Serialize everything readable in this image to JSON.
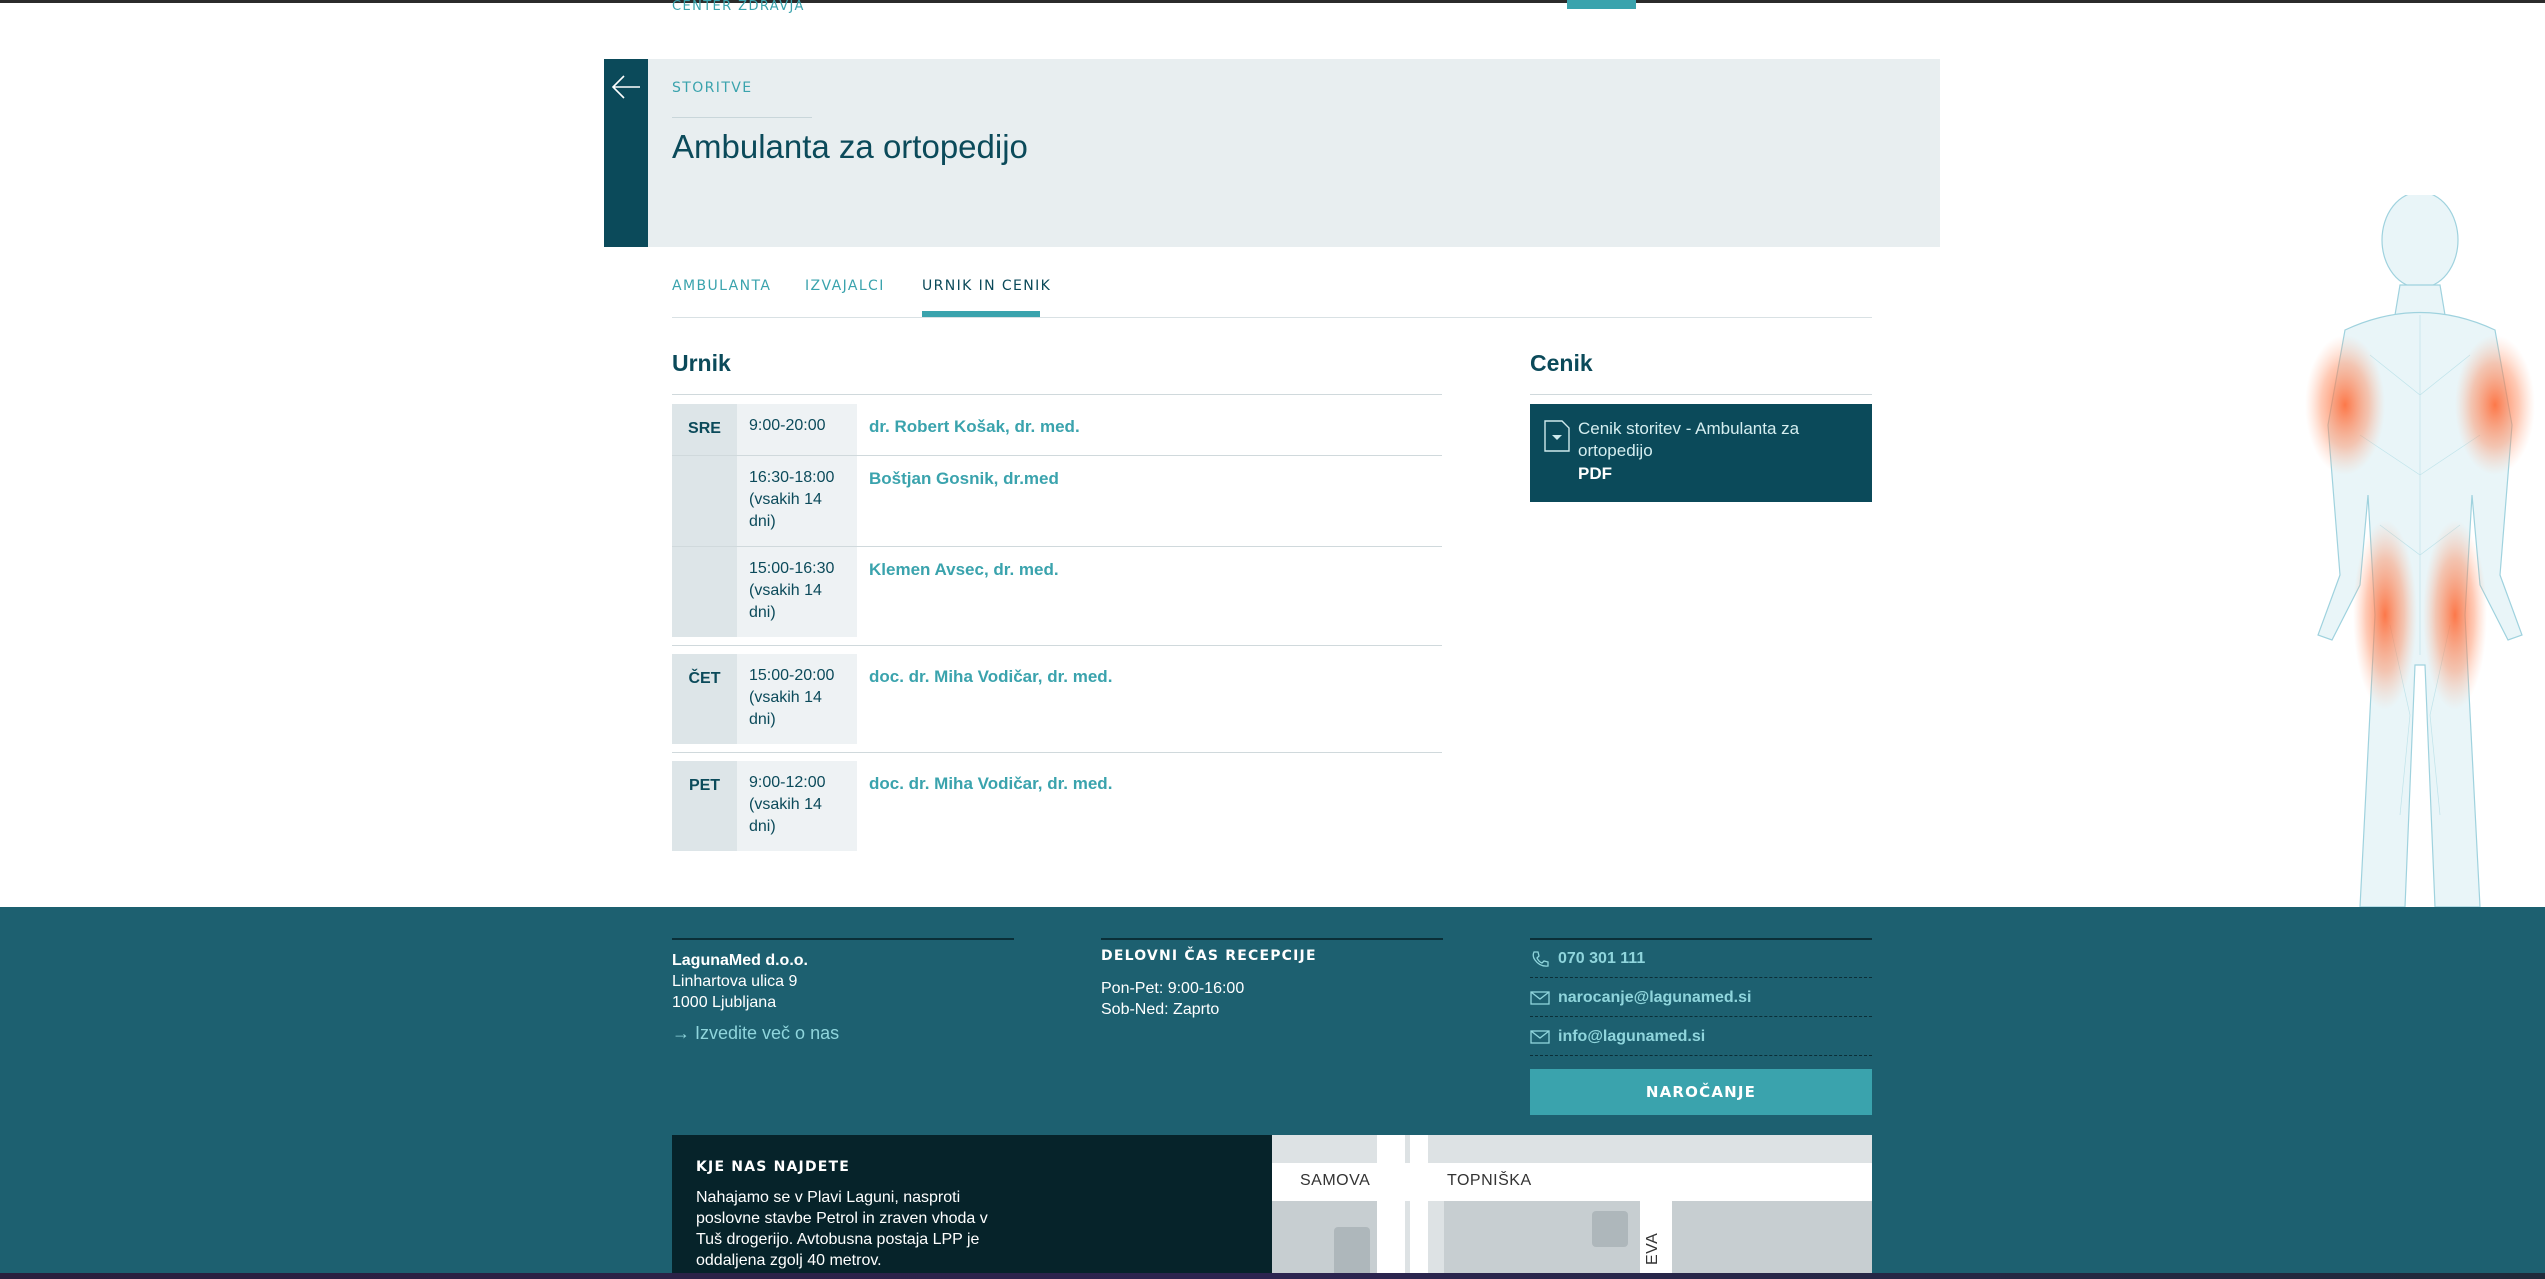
{
  "top": {
    "crumb": "CENTER ZDRAVJA"
  },
  "header": {
    "kicker": "STORITVE",
    "title": "Ambulanta za ortopedijo"
  },
  "tabs": [
    {
      "label": "AMBULANTA"
    },
    {
      "label": "IZVAJALCI"
    },
    {
      "label": "URNIK IN CENIK"
    }
  ],
  "urnik": {
    "title": "Urnik",
    "rows": [
      {
        "day": "SRE",
        "time": "9:00-20:00",
        "doctor": "dr. Robert Košak, dr. med."
      },
      {
        "day": "",
        "time": "16:30-18:00 (vsakih 14 dni)",
        "doctor": "Boštjan Gosnik, dr.med"
      },
      {
        "day": "",
        "time": "15:00-16:30 (vsakih 14 dni)",
        "doctor": "Klemen Avsec, dr. med."
      },
      {
        "day": "ČET",
        "time": "15:00-20:00 (vsakih 14 dni)",
        "doctor": "doc. dr. Miha Vodičar, dr. med."
      },
      {
        "day": "PET",
        "time": "9:00-12:00 (vsakih 14 dni)",
        "doctor": "doc. dr. Miha Vodičar, dr. med."
      }
    ]
  },
  "cenik": {
    "title": "Cenik",
    "file_label": "Cenik storitev - Ambulanta za ortopedijo",
    "file_type": "PDF"
  },
  "footer": {
    "company_name": "LagunaMed d.o.o.",
    "address_line1": "Linhartova ulica 9",
    "address_line2": "1000 Ljubljana",
    "more_link": "Izvedite več o nas",
    "hours_title": "DELOVNI ČAS RECEPCIJE",
    "hours_line1": "Pon-Pet: 9:00-16:00",
    "hours_line2": "Sob-Ned: Zaprto",
    "phone": "070 301 111",
    "email_booking": "narocanje@lagunamed.si",
    "email_info": "info@lagunamed.si",
    "order_button": "NAROČANJE",
    "findus_title": "KJE NAS NAJDETE",
    "findus_text": "Nahajamo se v Plavi Laguni, nasproti poslovne stavbe Petrol in zraven vhoda v Tuš drogerijo. Avtobusna postaja LPP je oddaljena zgolj 40 metrov.",
    "map_labels": [
      "SAMOVA",
      "TOPNIŠKA",
      "EVA"
    ]
  },
  "colors": {
    "brand_dark": "#0b4a5a",
    "brand_accent": "#3aa3ad",
    "footer_bg": "#1d6070",
    "highlight": "#ff7a4a"
  }
}
